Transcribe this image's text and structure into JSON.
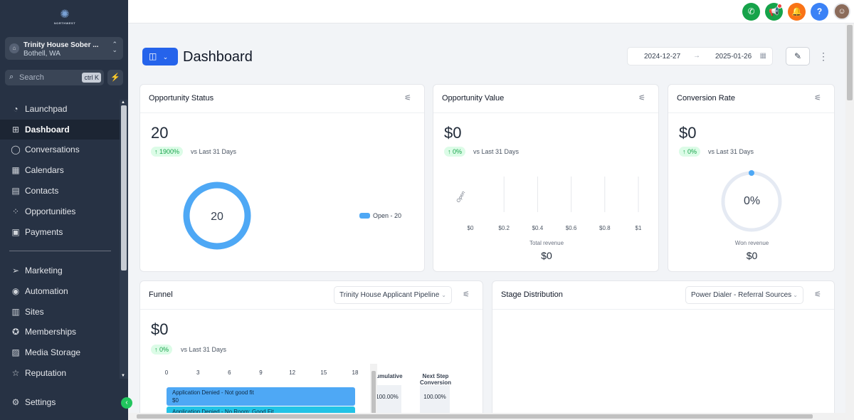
{
  "brand": {
    "logo_text": "NORTHWEST"
  },
  "location": {
    "name": "Trinity House Sober ...",
    "city": "Bothell, WA"
  },
  "search": {
    "placeholder": "Search",
    "shortcut": "ctrl K"
  },
  "nav": [
    {
      "label": "Launchpad",
      "icon": "launchpad-icon",
      "active": false
    },
    {
      "label": "Dashboard",
      "icon": "dashboard-grid-icon",
      "active": true
    },
    {
      "label": "Conversations",
      "icon": "chat-icon",
      "active": false
    },
    {
      "label": "Calendars",
      "icon": "calendar-icon",
      "active": false
    },
    {
      "label": "Contacts",
      "icon": "contacts-icon",
      "active": false
    },
    {
      "label": "Opportunities",
      "icon": "opportunities-icon",
      "active": false
    },
    {
      "label": "Payments",
      "icon": "payments-icon",
      "active": false
    },
    {
      "label": "Marketing",
      "icon": "send-icon",
      "active": false
    },
    {
      "label": "Automation",
      "icon": "automation-icon",
      "active": false
    },
    {
      "label": "Sites",
      "icon": "sites-icon",
      "active": false
    },
    {
      "label": "Memberships",
      "icon": "membership-icon",
      "active": false
    },
    {
      "label": "Media Storage",
      "icon": "image-icon",
      "active": false
    },
    {
      "label": "Reputation",
      "icon": "star-icon",
      "active": false
    }
  ],
  "settings_label": "Settings",
  "topbar_colors": {
    "phone": "#16a34a",
    "announce": "#16a34a",
    "bell": "#f97316",
    "help": "#3b82f6"
  },
  "header": {
    "title": "Dashboard",
    "date_start": "2024-12-27",
    "date_end": "2025-01-26"
  },
  "opportunity_status": {
    "title": "Opportunity Status",
    "value": "20",
    "change": "1900%",
    "vs": "vs Last 31 Days",
    "donut_center": "20",
    "legend": "Open - 20",
    "segments": [
      {
        "name": "Open",
        "value": 20,
        "color": "#4ea8f5"
      }
    ]
  },
  "opportunity_value": {
    "title": "Opportunity Value",
    "value": "$0",
    "change": "0%",
    "vs": "vs Last 31 Days",
    "footer_label": "Total revenue",
    "footer_value": "$0"
  },
  "conversion_rate": {
    "title": "Conversion Rate",
    "value": "$0",
    "change": "0%",
    "vs": "vs Last 31 Days",
    "gauge_label": "0%",
    "gauge_value": 0,
    "footer_label": "Won revenue",
    "footer_value": "$0"
  },
  "funnel": {
    "title": "Funnel",
    "pipeline": "Trinity House Applicant Pipeline",
    "value": "$0",
    "change": "0%",
    "vs": "vs Last 31 Days",
    "col_cumulative": "Cumulative",
    "col_next": "Next Step Conversion",
    "rows": [
      {
        "label": "Application Denied - Not good fit",
        "amount": "$0",
        "count": 20,
        "color": "#4ea8f5",
        "cumulative": "100.00%",
        "next": "100.00%"
      },
      {
        "label": "Application Denied - No Room: Good Fit",
        "amount": "",
        "count": 20,
        "color": "#22c3e6",
        "cumulative": "",
        "next": ""
      }
    ]
  },
  "stage_distribution": {
    "title": "Stage Distribution",
    "pipeline": "Power Dialer - Referral Sources"
  },
  "chart_data": [
    {
      "type": "pie",
      "categories": [
        "Open"
      ],
      "values": [
        20
      ],
      "legend": "right"
    },
    {
      "type": "bar",
      "orientation": "horizontal",
      "categories": [
        "Open"
      ],
      "values": [
        0
      ],
      "xlim": [
        0,
        1
      ],
      "xticks": [
        "$0",
        "$0.2",
        "$0.4",
        "$0.6",
        "$0.8",
        "$1"
      ]
    },
    {
      "type": "bar",
      "orientation": "horizontal",
      "categories": [
        "Application Denied - Not good fit",
        "Application Denied - No Room: Good Fit"
      ],
      "values": [
        20,
        20
      ],
      "xlim": [
        0,
        18
      ],
      "xticks": [
        "0",
        "3",
        "6",
        "9",
        "12",
        "15",
        "18"
      ]
    }
  ]
}
